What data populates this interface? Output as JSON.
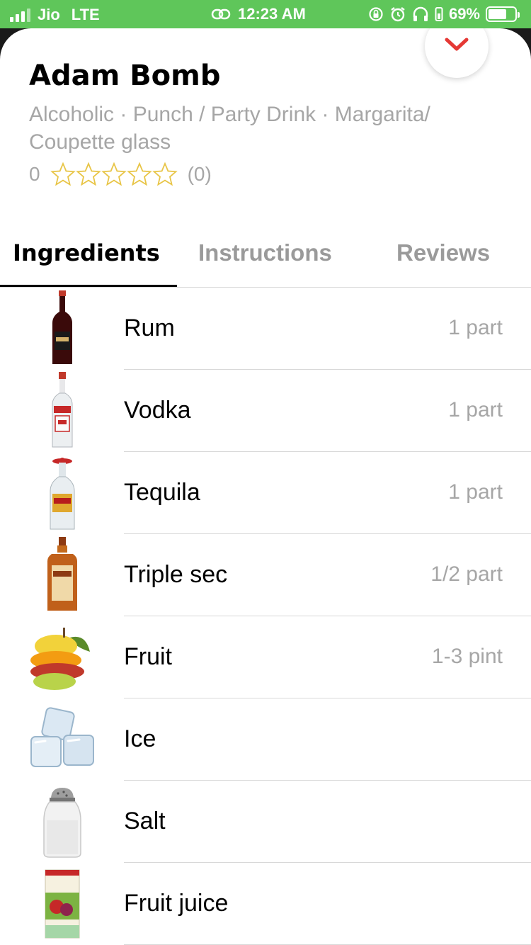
{
  "status_bar": {
    "carrier": "Jio",
    "network": "LTE",
    "time": "12:23 AM",
    "battery": "69%",
    "battery_level": 0.69
  },
  "drink": {
    "title": "Adam Bomb",
    "subtitle": "Alcoholic · Punch / Party Drink · Margarita/ Coupette glass",
    "rating_value": "0",
    "rating_count": "(0)",
    "stars_filled": 0,
    "stars_total": 5
  },
  "tabs": [
    {
      "label": "Ingredients",
      "active": true
    },
    {
      "label": "Instructions",
      "active": false
    },
    {
      "label": "Reviews",
      "active": false
    }
  ],
  "ingredients": [
    {
      "name": "Rum",
      "measure": "1 part",
      "icon": "rum-bottle-icon"
    },
    {
      "name": "Vodka",
      "measure": "1 part",
      "icon": "vodka-bottle-icon"
    },
    {
      "name": "Tequila",
      "measure": "1 part",
      "icon": "tequila-bottle-icon"
    },
    {
      "name": "Triple sec",
      "measure": "1/2 part",
      "icon": "triple-sec-bottle-icon"
    },
    {
      "name": "Fruit",
      "measure": "1-3 pint",
      "icon": "fruit-icon"
    },
    {
      "name": "Ice",
      "measure": "",
      "icon": "ice-cubes-icon"
    },
    {
      "name": "Salt",
      "measure": "",
      "icon": "salt-shaker-icon"
    },
    {
      "name": "Fruit juice",
      "measure": "",
      "icon": "juice-box-icon"
    }
  ],
  "colors": {
    "status_bar": "#5fc65a",
    "accent": "#e53935",
    "star": "#e8c547",
    "muted_text": "#a6a6a6"
  }
}
